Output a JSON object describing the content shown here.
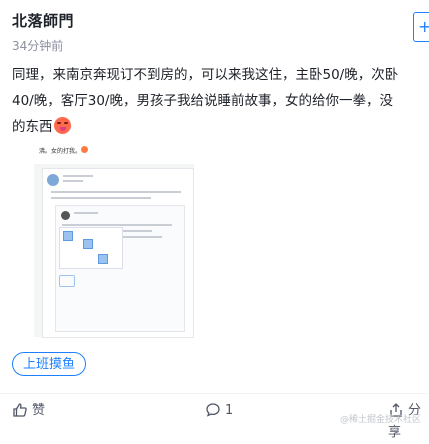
{
  "post": {
    "author": "北落師門",
    "time": "34分钟前",
    "follow_icon": "plus-icon",
    "content_lines": [
      "同理，来南京奔现订不到房的，可以来我这住，主卧50/晚，次卧",
      "40/晚，客厅30/晚，男孩子我给说睡前故事，女的给你一拳，没",
      "的东西"
    ],
    "emoji": "tongue-face-emoji",
    "tag": "上班摸鱼"
  },
  "screenshot_preview": {
    "header_text": "沸。女的打我。"
  },
  "actions": {
    "like_label": "赞",
    "comment_count": "1",
    "share_label": "分享"
  },
  "watermark": "@稀土掘金技术社区",
  "colors": {
    "accent": "#1e80ff",
    "text": "#1d2129",
    "muted": "#8a919f"
  }
}
